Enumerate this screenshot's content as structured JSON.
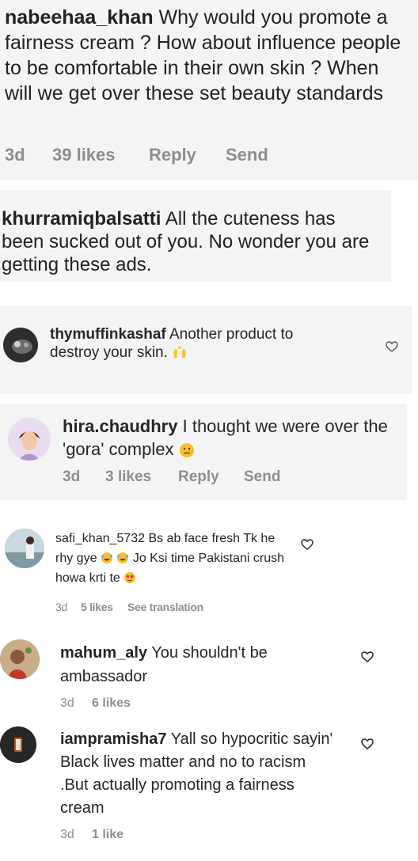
{
  "comments": [
    {
      "username": "nabeehaa_khan",
      "text": "Why would you promote a fairness cream ? How about influence people to be comfortable in their own skin ? When will we get over these set beauty standards",
      "time": "3d",
      "likes": "39 likes",
      "reply": "Reply",
      "send": "Send"
    },
    {
      "username": "khurramiqbalsatti",
      "text": "All the cuteness has been sucked out of you. No wonder you are getting these ads."
    },
    {
      "username": "thymuffinkashaf",
      "text": "Another product to destroy your skin.",
      "emoji": "raising-hands-emoji"
    },
    {
      "username": "hira.chaudhry",
      "text": "I thought we were over the 'gora' complex",
      "emoji": "crying-face-emoji",
      "time": "3d",
      "likes": "3 likes",
      "reply": "Reply",
      "send": "Send"
    },
    {
      "username": "safi_khan_5732",
      "text_part1": "Bs ab face fresh Tk he rhy gye",
      "text_part2": "Jo Ksi time Pakistani crush howa krti te",
      "time": "3d",
      "likes": "5 likes",
      "see_translation": "See translation"
    },
    {
      "username": "mahum_aly",
      "text": "You shouldn't be ambassador",
      "time": "3d",
      "likes": "6 likes"
    },
    {
      "username": "iampramisha7",
      "text": "Yall so hypocritic sayin' Black lives matter and no to racism .But actually promoting a fairness cream",
      "time": "3d",
      "likes": "1 like"
    }
  ],
  "colors": {
    "text": "#262626",
    "meta": "#8e8e8e",
    "panel": "#f4f4f4"
  }
}
